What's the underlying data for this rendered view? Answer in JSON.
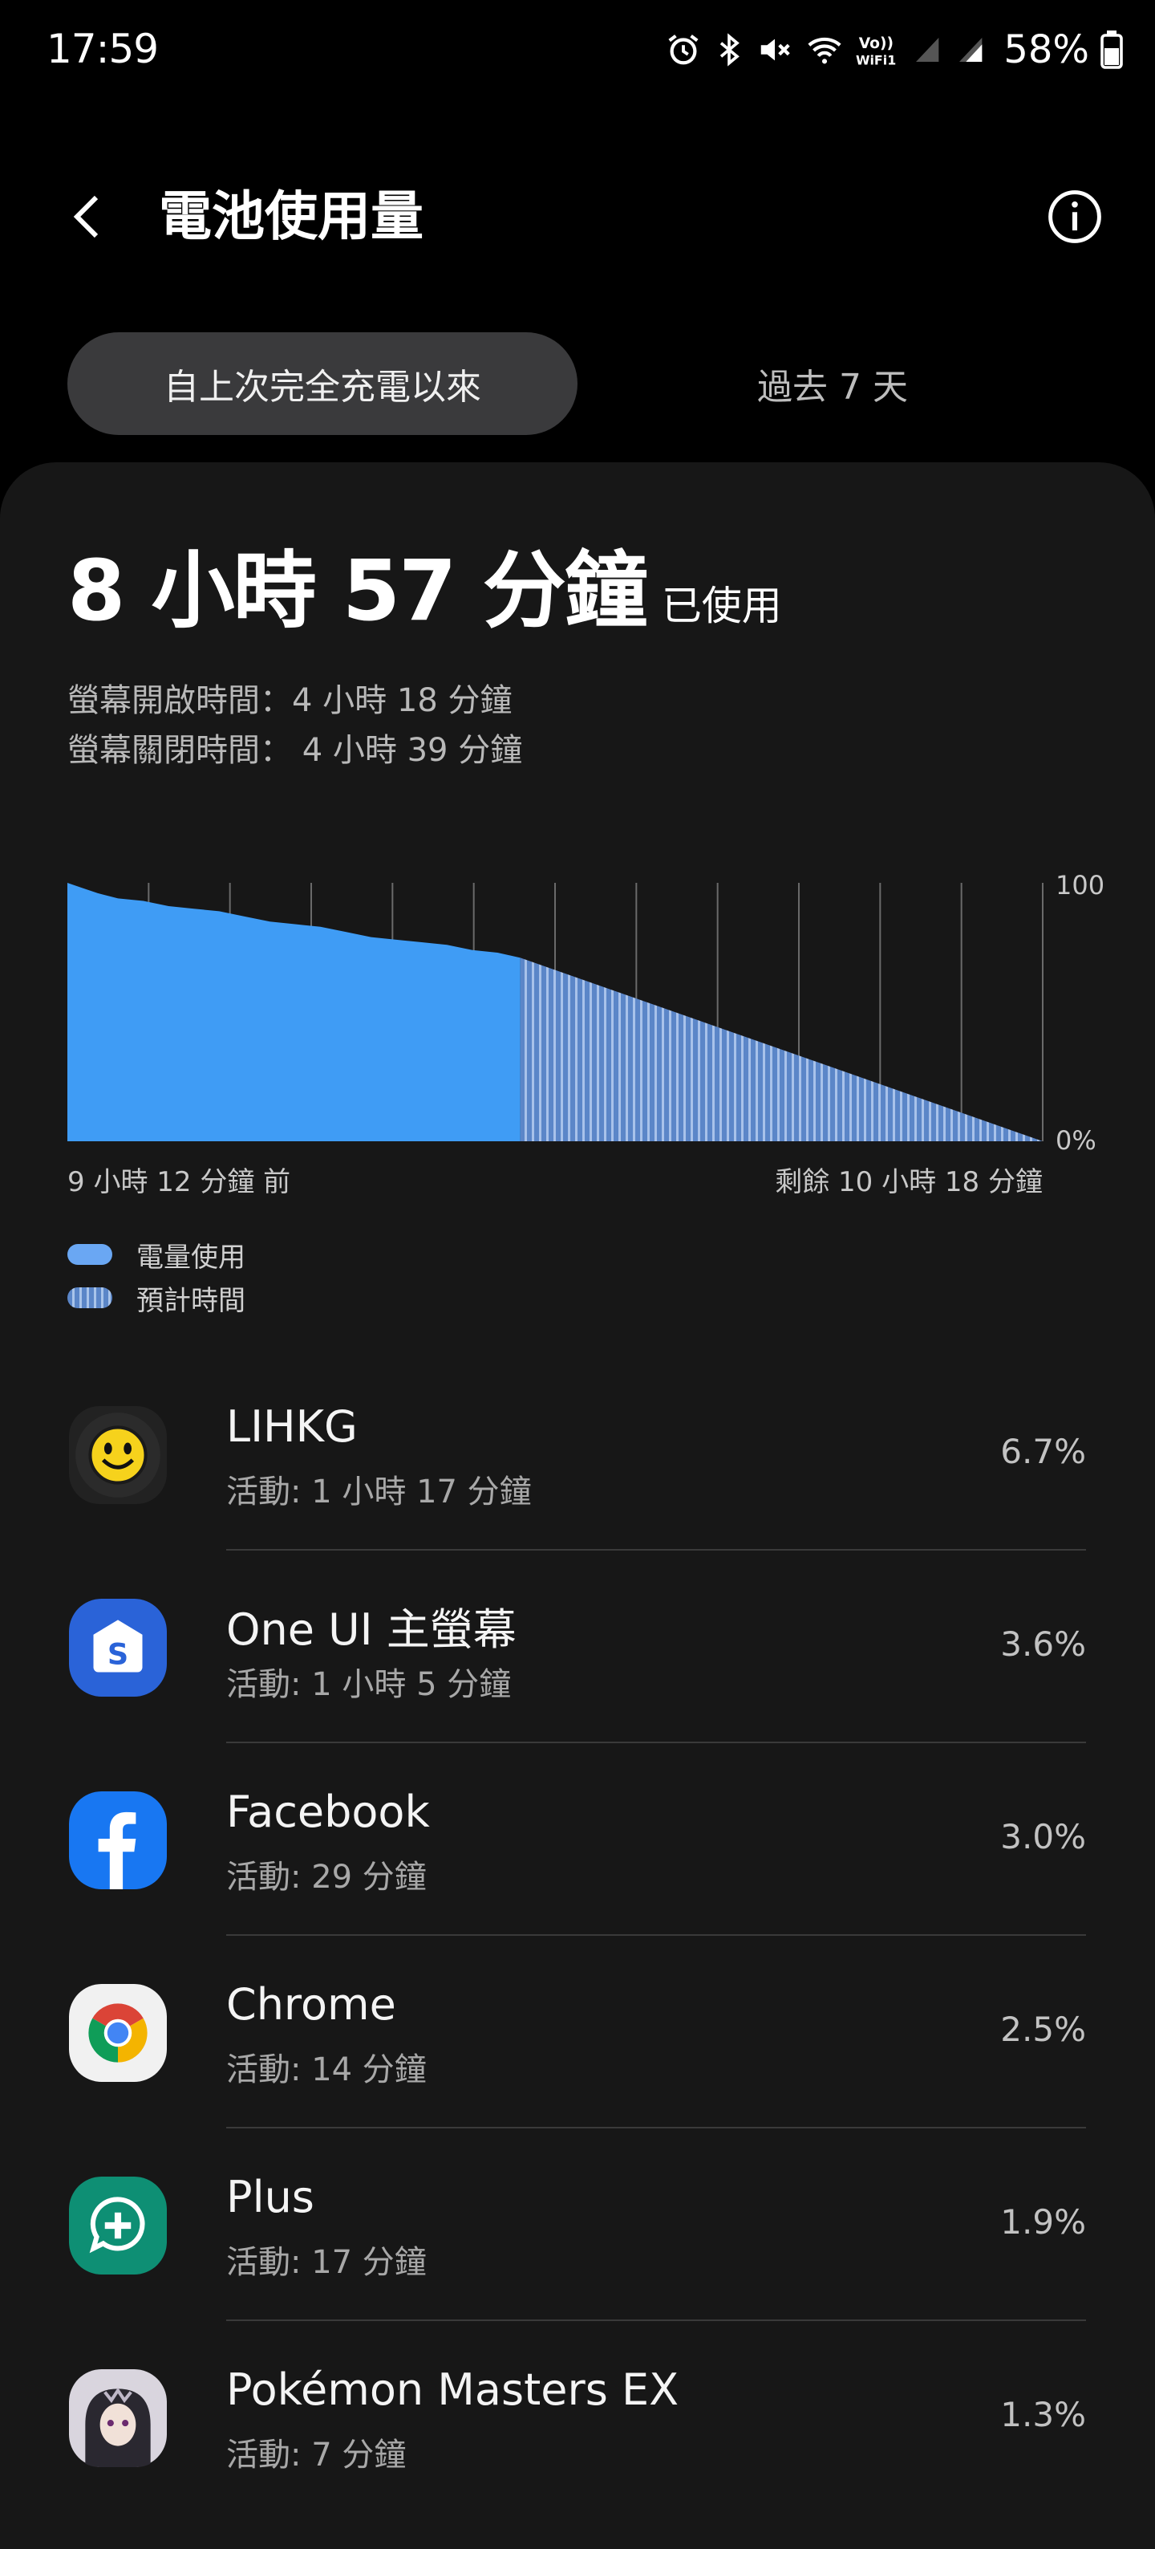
{
  "status_bar": {
    "time": "17:59",
    "battery": "58%",
    "volte_label": "Vo)) WiFi1"
  },
  "header": {
    "title": "電池使用量"
  },
  "tabs": [
    {
      "label": "自上次完全充電以來",
      "active": true
    },
    {
      "label": "過去 7 天",
      "active": false
    }
  ],
  "summary": {
    "duration": "8 小時 57 分鐘",
    "used_suffix": "已使用",
    "screen_on": "螢幕開啟時間：4 小時 18 分鐘",
    "screen_off": "螢幕關閉時間： 4 小時 39 分鐘"
  },
  "chart_data": {
    "type": "area",
    "ylim": [
      0,
      100
    ],
    "y_tick_labels": [
      "100",
      "0%"
    ],
    "x_label_left": "9 小時 12 分鐘 前",
    "x_label_right": "剩餘 10 小時 18 分鐘",
    "series": [
      {
        "name": "電量使用",
        "x_hours": [
          0,
          0.3,
          0.6,
          1.0,
          1.5,
          2.0,
          2.5,
          3.0,
          3.5,
          4.0,
          4.5,
          5.0,
          5.5,
          6.0,
          6.5,
          7.0,
          7.5,
          8.0,
          8.5,
          8.95
        ],
        "values": [
          100,
          98,
          96,
          94,
          93,
          91,
          90,
          89,
          87,
          85,
          84,
          83,
          81,
          79,
          78,
          77,
          76,
          74,
          73,
          71
        ]
      },
      {
        "name": "預計時間",
        "x_hours": [
          8.95,
          19.27
        ],
        "values": [
          71,
          0
        ]
      }
    ],
    "colors": {
      "usage": "#3f9cf5",
      "estimate": "#5b86c8"
    }
  },
  "legend": [
    {
      "label": "電量使用",
      "color": "#6aa7f3"
    },
    {
      "label": "預計時間",
      "color": "#5b86c8"
    }
  ],
  "apps": [
    {
      "name": "LIHKG",
      "activity": "活動: 1 小時 17 分鐘",
      "percent": "6.7%",
      "icon": "lihkg-smiley-icon"
    },
    {
      "name": "One UI 主螢幕",
      "activity": "活動: 1 小時 5 分鐘",
      "percent": "3.6%",
      "icon": "one-ui-home-icon"
    },
    {
      "name": "Facebook",
      "activity": "活動: 29 分鐘",
      "percent": "3.0%",
      "icon": "facebook-icon"
    },
    {
      "name": "Chrome",
      "activity": "活動: 14 分鐘",
      "percent": "2.5%",
      "icon": "chrome-icon"
    },
    {
      "name": "Plus",
      "activity": "活動: 17 分鐘",
      "percent": "1.9%",
      "icon": "plus-messenger-icon"
    },
    {
      "name": "Pokémon Masters EX",
      "activity": "活動: 7 分鐘",
      "percent": "1.3%",
      "icon": "pokemon-masters-icon"
    }
  ]
}
